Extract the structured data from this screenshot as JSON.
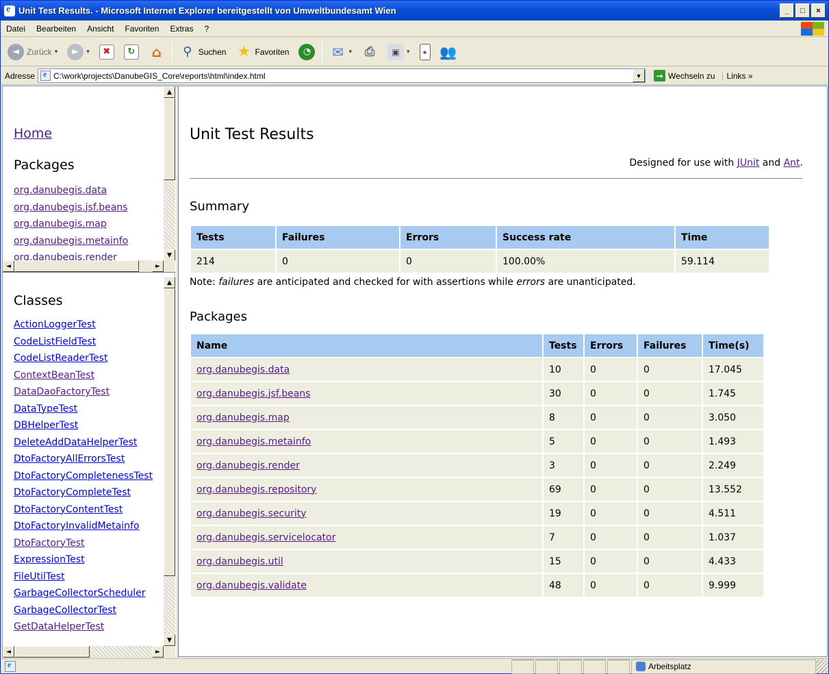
{
  "window": {
    "title": "Unit Test Results. - Microsoft Internet Explorer bereitgestellt von Umweltbundesamt Wien",
    "min": "_",
    "max": "□",
    "close": "×"
  },
  "menu": [
    "Datei",
    "Bearbeiten",
    "Ansicht",
    "Favoriten",
    "Extras",
    "?"
  ],
  "toolbar": {
    "back_label": "Zurück",
    "search_label": "Suchen",
    "favorites_label": "Favoriten"
  },
  "address": {
    "label": "Adresse",
    "url": "C:\\work\\projects\\DanubeGIS_Core\\reports\\html\\index.html",
    "go_label": "Wechseln zu",
    "links_label": "Links »"
  },
  "nav": {
    "home": "Home",
    "packages_heading": "Packages",
    "packages": [
      "org.danubegis.data",
      "org.danubegis.jsf.beans",
      "org.danubegis.map",
      "org.danubegis.metainfo",
      "org.danubegis.render"
    ],
    "classes_heading": "Classes",
    "classes": [
      "ActionLoggerTest",
      "CodeListFieldTest",
      "CodeListReaderTest",
      "ContextBeanTest",
      "DataDaoFactoryTest",
      "DataTypeTest",
      "DBHelperTest",
      "DeleteAddDataHelperTest",
      "DtoFactoryAllErrorsTest",
      "DtoFactoryCompletenessTest",
      "DtoFactoryCompleteTest",
      "DtoFactoryContentTest",
      "DtoFactoryInvalidMetainfo",
      "DtoFactoryTest",
      "ExpressionTest",
      "FileUtilTest",
      "GarbageCollectorScheduler",
      "GarbageCollectorTest",
      "GetDataHelperTest"
    ]
  },
  "main": {
    "title": "Unit Test Results",
    "designed_prefix": "Designed for use with",
    "designed_link1": "JUnit",
    "designed_and": "and",
    "designed_link2": "Ant",
    "designed_suffix": ".",
    "summary_heading": "Summary",
    "summary_headers": [
      "Tests",
      "Failures",
      "Errors",
      "Success rate",
      "Time"
    ],
    "summary_values": [
      "214",
      "0",
      "0",
      "100.00%",
      "59.114"
    ],
    "note_prefix": "Note:",
    "note_failures": "failures",
    "note_mid": "are anticipated and checked for with assertions while",
    "note_errors": "errors",
    "note_suffix": "are unanticipated.",
    "packages_heading": "Packages",
    "package_headers": [
      "Name",
      "Tests",
      "Errors",
      "Failures",
      "Time(s)"
    ],
    "packages": [
      [
        "org.danubegis.data",
        "10",
        "0",
        "0",
        "17.045"
      ],
      [
        "org.danubegis.jsf.beans",
        "30",
        "0",
        "0",
        "1.745"
      ],
      [
        "org.danubegis.map",
        "8",
        "0",
        "0",
        "3.050"
      ],
      [
        "org.danubegis.metainfo",
        "5",
        "0",
        "0",
        "1.493"
      ],
      [
        "org.danubegis.render",
        "3",
        "0",
        "0",
        "2.249"
      ],
      [
        "org.danubegis.repository",
        "69",
        "0",
        "0",
        "13.552"
      ],
      [
        "org.danubegis.security",
        "19",
        "0",
        "0",
        "4.511"
      ],
      [
        "org.danubegis.servicelocator",
        "7",
        "0",
        "0",
        "1.037"
      ],
      [
        "org.danubegis.util",
        "15",
        "0",
        "0",
        "4.433"
      ],
      [
        "org.danubegis.validate",
        "48",
        "0",
        "0",
        "9.999"
      ]
    ]
  },
  "status": {
    "zone": "Arbeitsplatz"
  }
}
